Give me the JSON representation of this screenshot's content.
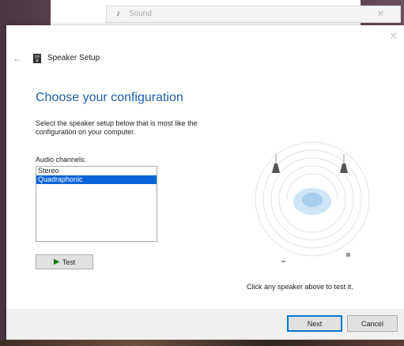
{
  "background_window": {
    "title": "Sound",
    "close_glyph": "✕"
  },
  "dialog": {
    "close_glyph": "✕",
    "back_glyph": "←",
    "app_title": "Speaker Setup",
    "heading": "Choose your configuration",
    "instruction": "Select the speaker setup below that is most like the configuration on your computer.",
    "channels_label": "Audio channels:",
    "channels": [
      {
        "label": "Stereo",
        "selected": false
      },
      {
        "label": "Quadraphonic",
        "selected": true
      }
    ],
    "test_label": "Test",
    "hint": "Click any speaker above to test it.",
    "next_label": "Next",
    "cancel_label": "Cancel"
  },
  "colors": {
    "heading": "#1f5ea8",
    "selection": "#0a64d8",
    "default_button_border": "#0078d7",
    "play": "#1b7a1b"
  },
  "icons": {
    "back": "back-arrow-icon",
    "app": "speaker-setup-icon",
    "test": "play-icon",
    "close": "close-icon"
  }
}
